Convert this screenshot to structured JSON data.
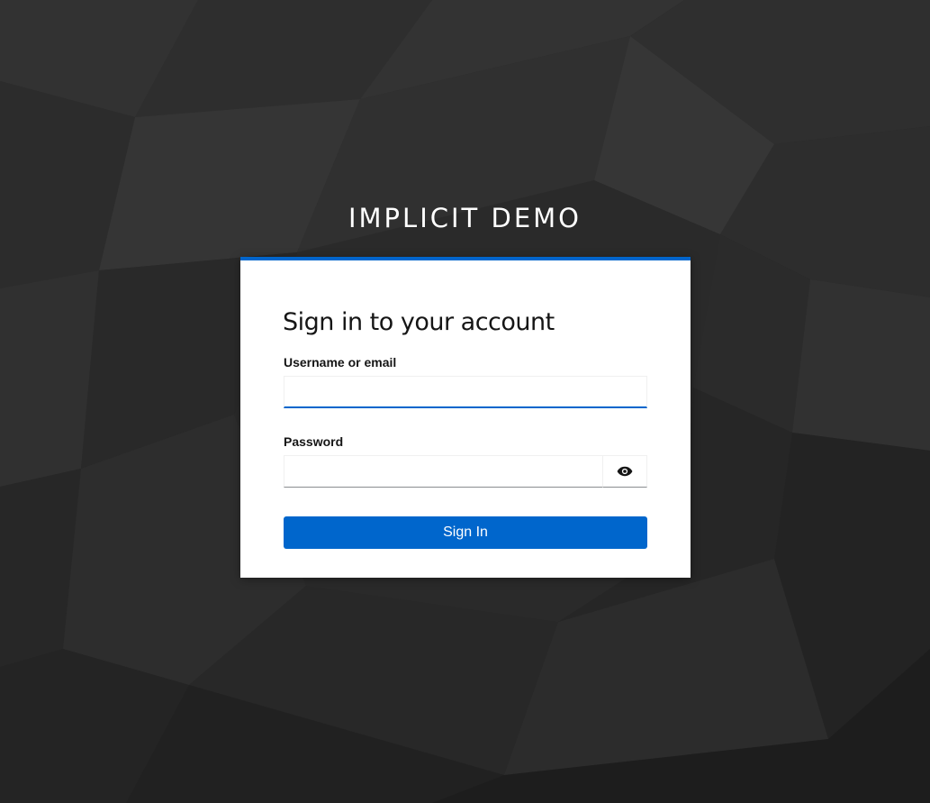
{
  "realm": {
    "title": "IMPLICIT DEMO"
  },
  "login": {
    "heading": "Sign in to your account",
    "username_label": "Username or email",
    "username_value": "",
    "password_label": "Password",
    "password_value": "",
    "sign_in_label": "Sign In"
  },
  "icons": {
    "password_toggle": "eye-icon"
  },
  "colors": {
    "background": "#2b2b2b",
    "card_background": "#ffffff",
    "accent": "#0066cc",
    "text": "#151515",
    "title_text": "#ffffff"
  }
}
